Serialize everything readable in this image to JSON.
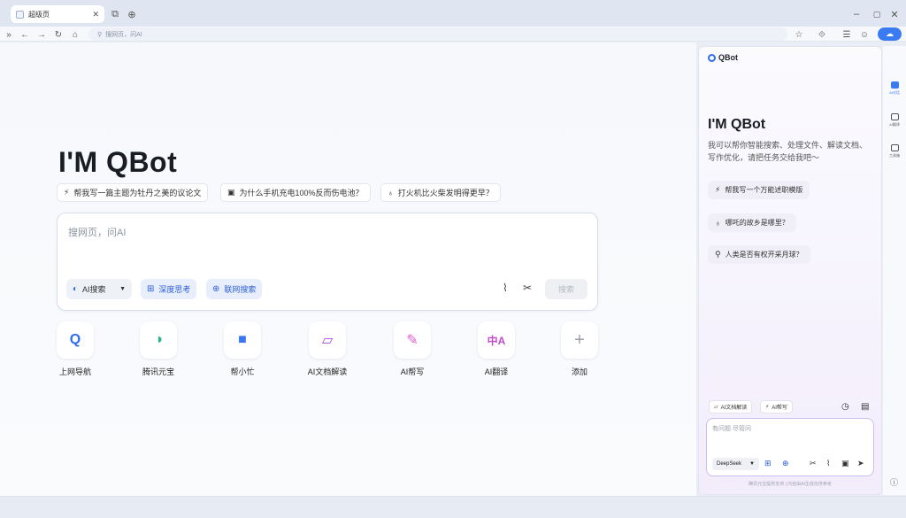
{
  "browser": {
    "tab_title": "超级页",
    "search_placeholder": "搜网页，问AI",
    "colors": {
      "accent": "#3a7bf2"
    }
  },
  "main": {
    "hero_title": "I'M QBot",
    "suggestions": [
      {
        "icon": "magic-icon",
        "label": "帮我写一篇主题为牡丹之美的议论文"
      },
      {
        "icon": "chat-icon",
        "label": "为什么手机充电100%反而伤电池？"
      },
      {
        "icon": "bulb-icon",
        "label": "打火机比火柴发明得更早？"
      }
    ],
    "search": {
      "placeholder": "搜网页，问AI",
      "mode": "AI搜索",
      "deep_think": "深度思考",
      "web_search": "联网搜索",
      "submit": "搜索"
    },
    "apps": [
      {
        "icon": "q-icon",
        "label": "上网导航"
      },
      {
        "icon": "yuanbao-icon",
        "label": "腾讯元宝"
      },
      {
        "icon": "helper-icon",
        "label": "帮小忙"
      },
      {
        "icon": "doc-read-icon",
        "label": "AI文档解读"
      },
      {
        "icon": "wand-icon",
        "label": "AI帮写"
      },
      {
        "icon": "translate-icon",
        "label": "AI翻译"
      },
      {
        "icon": "plus-icon",
        "label": "添加"
      }
    ]
  },
  "panel": {
    "brand": "QBot",
    "title": "I'M QBot",
    "description": "我可以帮你智能搜索、处理文件、解读文档、写作优化，请把任务交给我吧～",
    "suggestions": [
      {
        "icon": "magic-icon",
        "label": "帮我写一个万能述职模版"
      },
      {
        "icon": "bulb-icon",
        "label": "哪吒的故乡是哪里？"
      },
      {
        "icon": "search-icon",
        "label": "人类是否有权开采月球？"
      }
    ],
    "tools": [
      "AI文档解读",
      "AI帮写"
    ],
    "input_placeholder": "有问题 尽管问",
    "model": "DeepSeek",
    "disclaimer": "腾讯元宝提供支持 | 内容由AI生成仅供参考"
  },
  "rail": {
    "items": [
      "AI对话",
      "AI翻译",
      "工具箱"
    ]
  }
}
